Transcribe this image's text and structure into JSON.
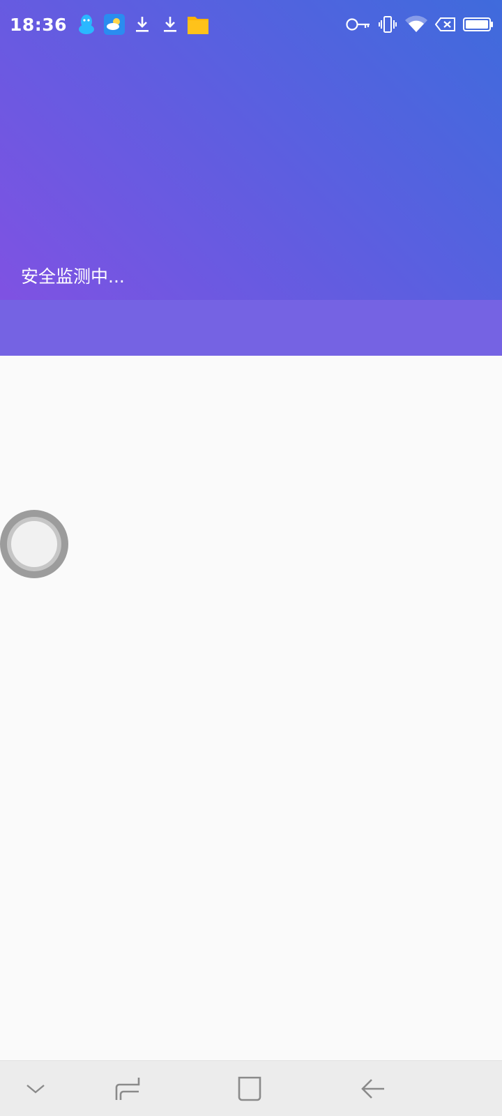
{
  "status_bar": {
    "time": "18:36",
    "left_icons": [
      "qq-icon",
      "weather-icon",
      "download-icon",
      "download-icon",
      "file-manager-icon"
    ],
    "right_icons": [
      "key-icon",
      "vibrate-icon",
      "wifi-icon",
      "battery-saver-icon",
      "battery-icon"
    ]
  },
  "header": {
    "status_text": "安全监测中...",
    "gradient_colors": [
      "#3f6bdc",
      "#5b5fe0",
      "#7f52e2"
    ],
    "band_color": "#7563e3"
  },
  "content": {
    "background": "#fafafa",
    "loading_indicator": "spinner"
  },
  "nav_bar": {
    "buttons": [
      "chevron-down-icon",
      "recents-icon",
      "home-icon",
      "back-icon"
    ]
  }
}
